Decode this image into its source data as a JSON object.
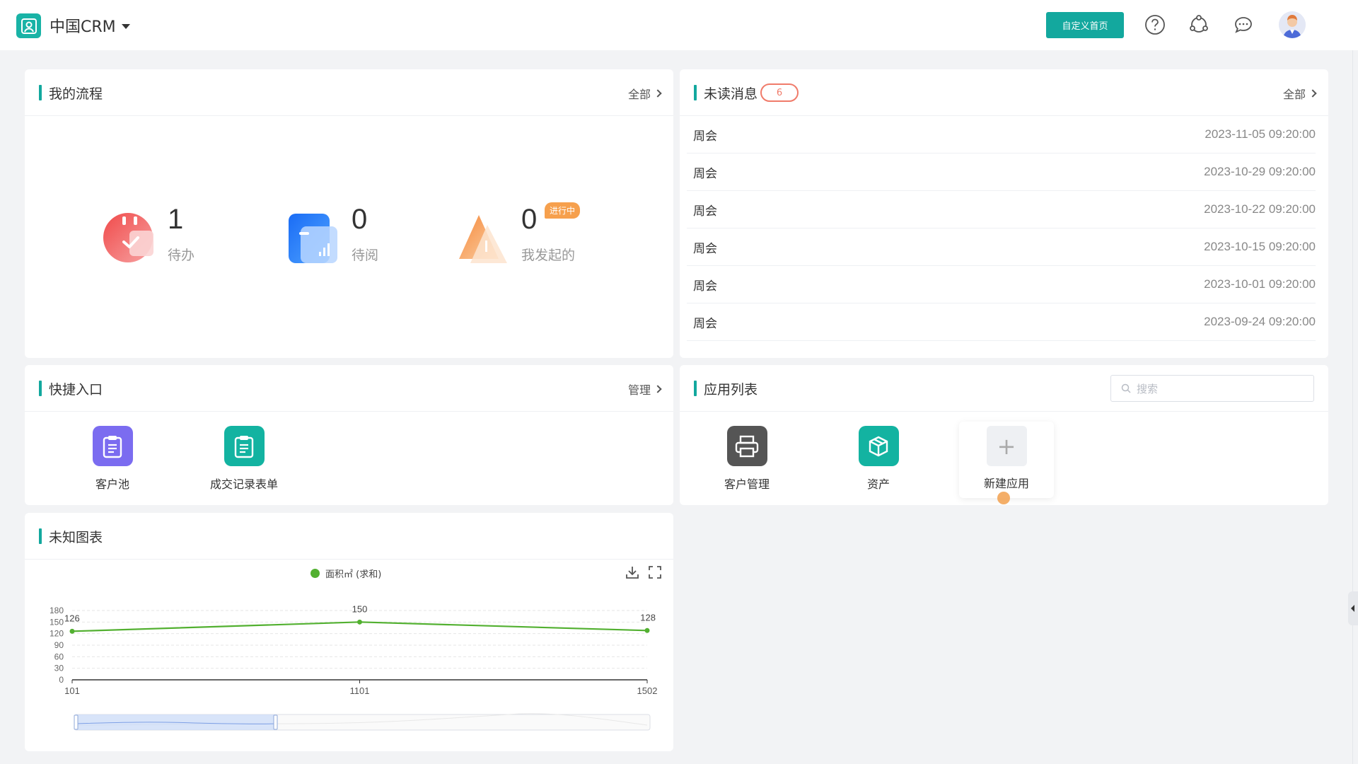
{
  "header": {
    "brand": "中国CRM",
    "custom_home_button": "自定义首页",
    "icons": [
      "help-icon",
      "share-network-icon",
      "chat-icon",
      "user-avatar"
    ]
  },
  "flow": {
    "title": "我的流程",
    "more": "全部",
    "stats": [
      {
        "value": "1",
        "label": "待办"
      },
      {
        "value": "0",
        "label": "待阅"
      },
      {
        "value": "0",
        "label": "我发起的"
      }
    ],
    "running_tag": "进行中"
  },
  "messages": {
    "title": "未读消息",
    "count": "6",
    "more": "全部",
    "items": [
      {
        "title": "周会",
        "time": "2023-11-05 09:20:00"
      },
      {
        "title": "周会",
        "time": "2023-10-29 09:20:00"
      },
      {
        "title": "周会",
        "time": "2023-10-22 09:20:00"
      },
      {
        "title": "周会",
        "time": "2023-10-15 09:20:00"
      },
      {
        "title": "周会",
        "time": "2023-10-01 09:20:00"
      },
      {
        "title": "周会",
        "time": "2023-09-24 09:20:00"
      }
    ]
  },
  "quick": {
    "title": "快捷入口",
    "more": "管理",
    "items": [
      {
        "label": "客户池",
        "color": "#7b6cf0"
      },
      {
        "label": "成交记录表单",
        "color": "#13b3a1"
      }
    ]
  },
  "apps": {
    "title": "应用列表",
    "search_placeholder": "搜索",
    "items": [
      {
        "label": "客户管理",
        "color": "#555555"
      },
      {
        "label": "资产",
        "color": "#13b3a1"
      }
    ],
    "new_app": "新建应用"
  },
  "chart": {
    "title": "未知图表",
    "legend": "面积㎡ (求和)",
    "colors": {
      "line": "#52b030"
    }
  },
  "chart_data": {
    "type": "line",
    "categories": [
      "101",
      "1101",
      "1502"
    ],
    "series": [
      {
        "name": "面积㎡ (求和)",
        "values": [
          126,
          150,
          128
        ]
      }
    ],
    "yticks": [
      0,
      30,
      60,
      90,
      120,
      150,
      180
    ],
    "ylim": [
      0,
      180
    ],
    "data_labels": [
      "126",
      "150",
      "128"
    ],
    "grid": true,
    "legend_position": "top-center",
    "datazoom": true
  }
}
